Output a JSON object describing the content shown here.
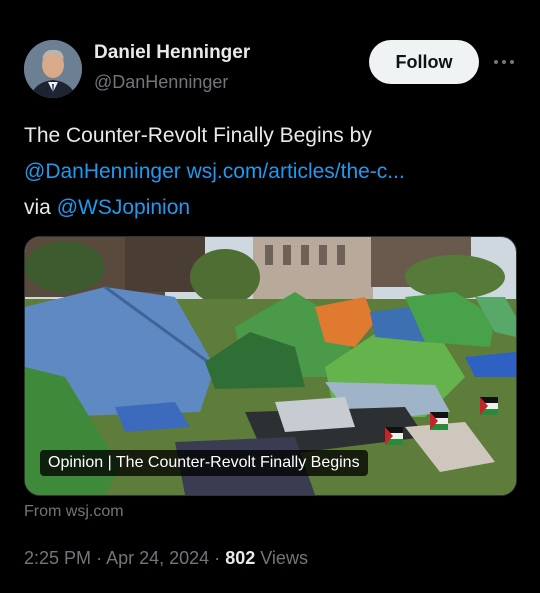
{
  "author": {
    "name": "Daniel Henninger",
    "handle": "@DanHenninger"
  },
  "follow_label": "Follow",
  "tweet": {
    "line1": "The Counter-Revolt Finally Begins by",
    "mention": "@DanHenninger",
    "link": "wsj.com/articles/the-c...",
    "via_label": "via",
    "via_mention": "@WSJopinion"
  },
  "card": {
    "caption": "Opinion | The Counter-Revolt Finally Begins",
    "source": "From wsj.com"
  },
  "meta": {
    "time": "2:25 PM",
    "separator": "·",
    "date": "Apr 24, 2024",
    "views_count": "802",
    "views_label": "Views"
  },
  "colors": {
    "background": "#000000",
    "text": "#e7e9ea",
    "secondary": "#71767b",
    "link": "#1d9bf0"
  },
  "icons": {
    "more": "more-horizontal-icon"
  }
}
